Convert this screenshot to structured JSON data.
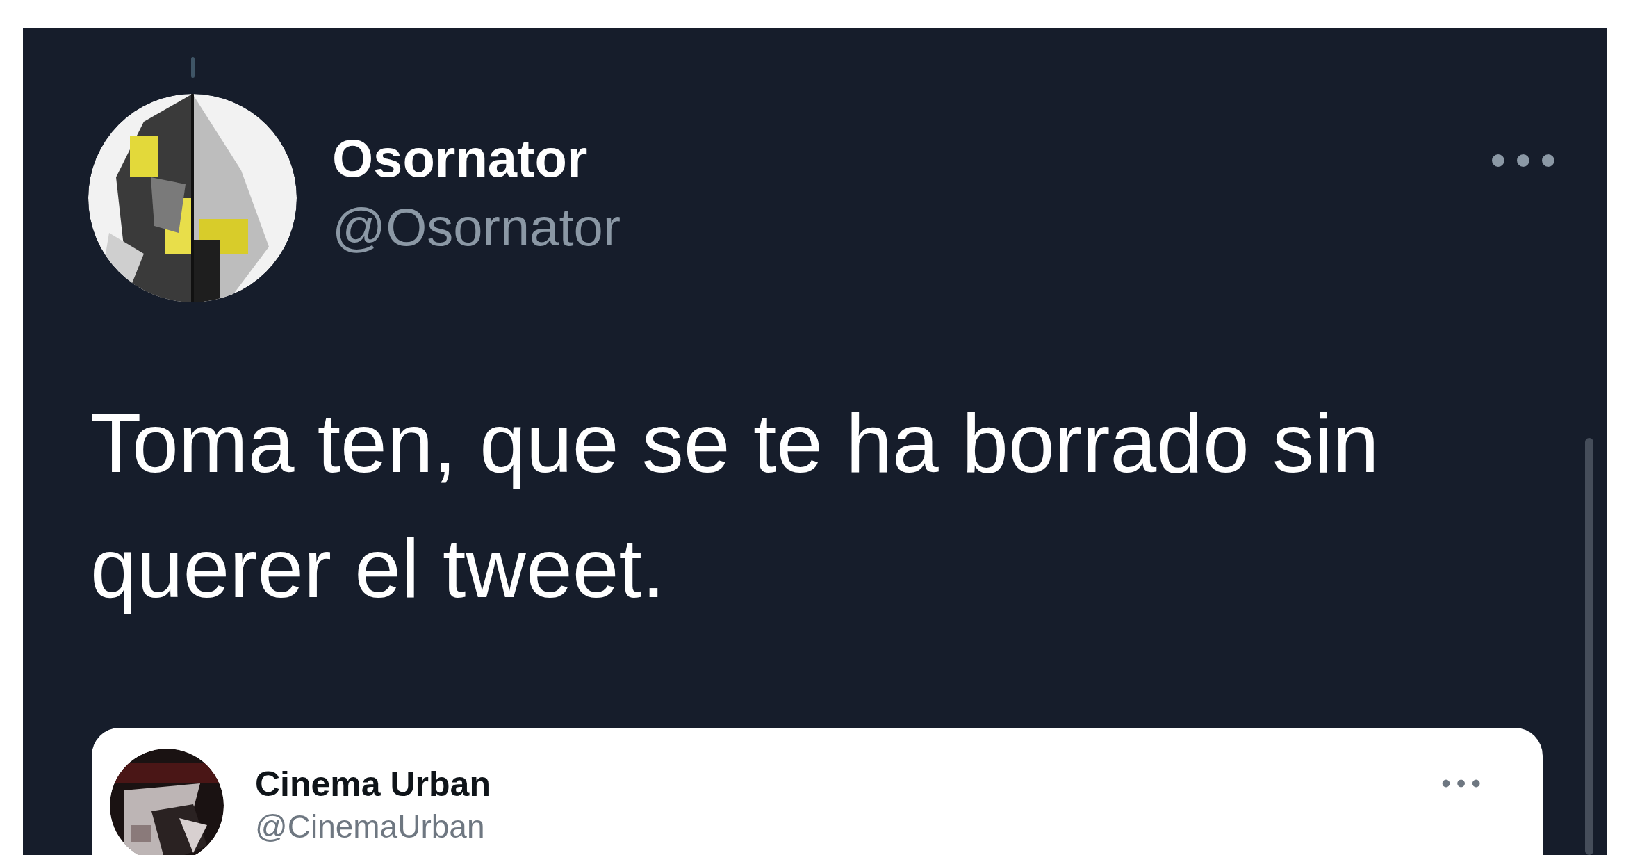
{
  "tweet": {
    "author": {
      "name": "Osornator",
      "handle": "@Osornator"
    },
    "text": "Toma ten, que se te ha borrado sin querer el tweet.",
    "quoted_tweet": {
      "author": {
        "name": "Cinema Urban",
        "handle": "@CinemaUrban"
      }
    }
  }
}
